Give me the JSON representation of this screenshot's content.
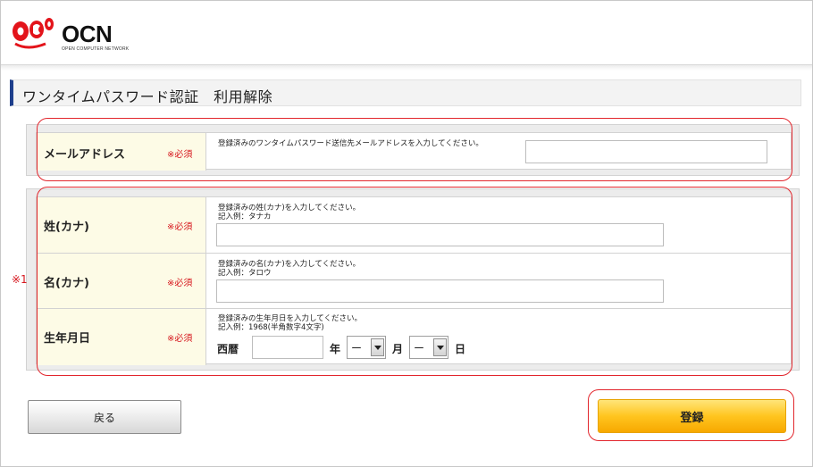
{
  "header": {
    "logo_text": "OCN",
    "logo_subtext": "OPEN COMPUTER NETWORK"
  },
  "page": {
    "title": "ワンタイムパスワード認証　利用解除"
  },
  "form": {
    "required_label": "※必須",
    "email": {
      "label": "メールアドレス",
      "hint": "登録済みのワンタイムパスワード送信先メールアドレスを入力してください。",
      "value": ""
    },
    "last_name": {
      "label": "姓(カナ)",
      "hint_line1": "登録済みの姓(カナ)を入力してください。",
      "hint_line2": "記入例：タナカ",
      "value": ""
    },
    "first_name": {
      "label": "名(カナ)",
      "hint_line1": "登録済みの名(カナ)を入力してください。",
      "hint_line2": "記入例：タロウ",
      "value": ""
    },
    "birthdate": {
      "label": "生年月日",
      "hint_line1": "登録済みの生年月日を入力してください。",
      "hint_line2": "記入例：1968(半角数字4文字)",
      "era_label": "西暦",
      "year_value": "",
      "year_unit": "年",
      "month_value": "ー",
      "month_unit": "月",
      "day_value": "ー",
      "day_unit": "日"
    }
  },
  "annotation": {
    "note_mark": "※1",
    "ring_color": "#e2262d"
  },
  "buttons": {
    "back_label": "戻る",
    "submit_label": "登録"
  },
  "colors": {
    "accent_blue": "#1e3f8c",
    "required_red": "#d6161d",
    "label_bg": "#fdfbe6",
    "submit_yellow": "#ffc51f"
  }
}
